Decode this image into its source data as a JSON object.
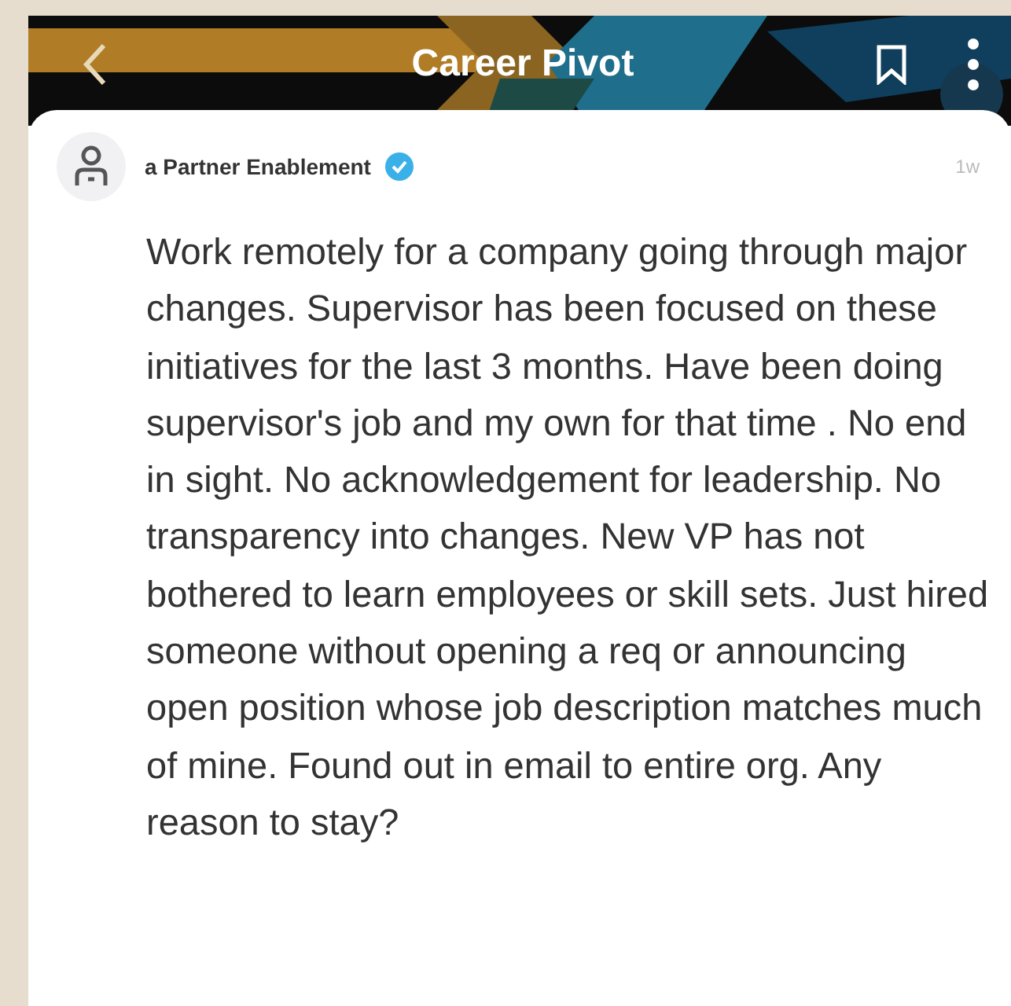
{
  "header": {
    "title": "Career Pivot"
  },
  "post": {
    "author": "a Partner Enablement",
    "verified": true,
    "time": "1w",
    "body": "Work remotely for a company going through major changes. Supervisor has been focused on these initiatives for the last 3 months. Have been doing supervisor's job and my own for that time . No end in sight.  No acknowledgement for leadership. No transparency into changes. New VP has not bothered to learn employees or skill sets. Just hired someone without opening a req or announcing open position whose job description matches much of mine. Found out in email to entire org.  Any reason to stay?"
  }
}
